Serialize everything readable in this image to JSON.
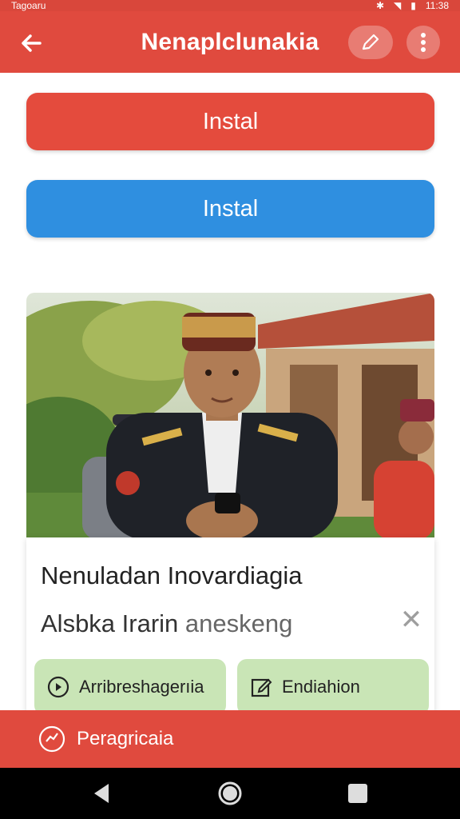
{
  "status_bar": {
    "left_text": "Tagoaru",
    "time": "11:38"
  },
  "app_bar": {
    "title": "Nenaplclunakia"
  },
  "buttons": {
    "install_primary": "Instal",
    "install_secondary": "Instal"
  },
  "card": {
    "title": "Nenuladan Inovardiagia",
    "subtitle_main": "Alsbka Irarin",
    "subtitle_muted": "aneskeng",
    "chips": [
      {
        "label": "Arribreshagerıia",
        "icon": "play-circle-icon"
      },
      {
        "label": "Endiahion",
        "icon": "edit-square-icon"
      }
    ]
  },
  "bottom_action": {
    "label": "Peragricaia",
    "icon": "clock-check-icon"
  },
  "colors": {
    "appbar": "#e04a3e",
    "primary_red": "#e44b3d",
    "blue": "#2f8fe0",
    "chip_green": "#c9e5b6"
  }
}
